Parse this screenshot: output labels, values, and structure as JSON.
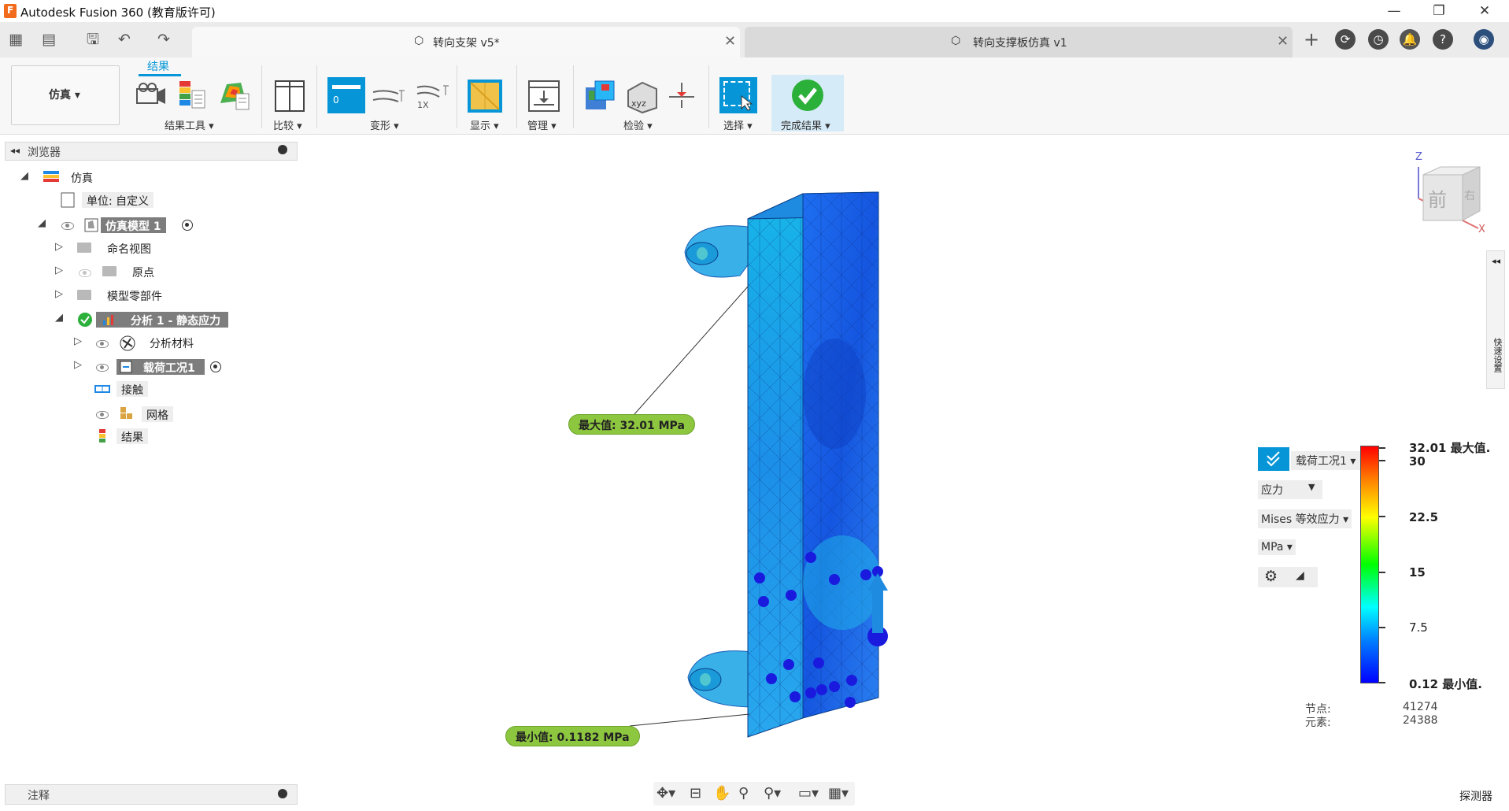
{
  "app": {
    "title": "Autodesk Fusion 360 (教育版许可)",
    "window_buttons": [
      "—",
      "❐",
      "✕"
    ]
  },
  "tabs": [
    {
      "label": "转向支架 v5*",
      "close": "✕",
      "active": true
    },
    {
      "label": "转向支撑板仿真 v1",
      "close": "✕",
      "active": false
    }
  ],
  "ribbon": {
    "workspace": "仿真 ▾",
    "active_tab": "结果",
    "groups": {
      "results_tools": "结果工具 ▾",
      "compare": "比较 ▾",
      "deform": "变形 ▾",
      "display": "显示 ▾",
      "manage": "管理 ▾",
      "inspect": "检验 ▾",
      "select": "选择 ▾",
      "finish": "完成结果 ▾"
    },
    "deform_values": [
      "0",
      "1X"
    ]
  },
  "browser": {
    "title": "浏览器",
    "items": [
      {
        "label": "仿真"
      },
      {
        "label": "单位: 自定义"
      },
      {
        "label": "仿真模型 1"
      },
      {
        "label": "命名视图"
      },
      {
        "label": "原点"
      },
      {
        "label": "模型零部件"
      },
      {
        "label": "分析 1 - 静态应力"
      },
      {
        "label": "分析材料"
      },
      {
        "label": "载荷工况1"
      },
      {
        "label": "接触"
      },
      {
        "label": "网格"
      },
      {
        "label": "结果"
      }
    ]
  },
  "notes": {
    "title": "注释"
  },
  "viewport": {
    "max_label": "最大值: 32.01 MPa",
    "min_label": "最小值: 0.1182 MPa",
    "viewcube_face": "前",
    "viewcube_side": "右",
    "axis_z": "Z",
    "axis_x": "X"
  },
  "right_panel": {
    "label": "快速设置"
  },
  "legend": {
    "load_case": "载荷工况1 ▾",
    "result_type": "应力",
    "result_subtype": "Mises 等效应力 ▾",
    "unit": "MPa ▾",
    "ticks": [
      "32.01 最大值.",
      "30",
      "22.5",
      "15",
      "7.5",
      "0.12 最小值."
    ],
    "nodes_label": "节点:",
    "nodes_value": "41274",
    "elements_label": "元素:",
    "elements_value": "24388",
    "colors": [
      "#ff0000",
      "#ffff00",
      "#00ff00",
      "#00ffff",
      "#0000ff"
    ]
  },
  "footer": {
    "probe": "探测器"
  }
}
